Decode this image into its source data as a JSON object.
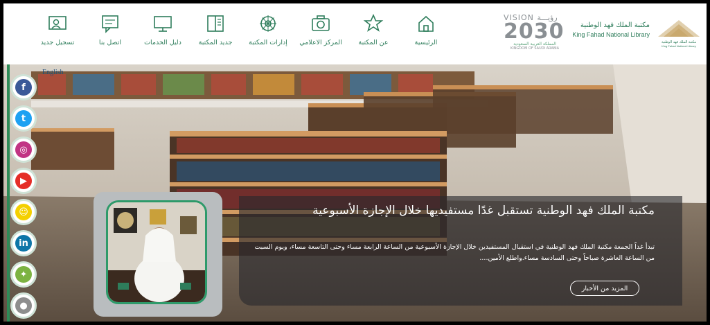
{
  "header": {
    "nav": [
      {
        "label": "الرئيسية",
        "icon": "home-icon"
      },
      {
        "label": "عن المكتبة",
        "icon": "star-icon"
      },
      {
        "label": "المركز الاعلامي",
        "icon": "camera-icon"
      },
      {
        "label": "إدارات المكتبة",
        "icon": "gear-icon"
      },
      {
        "label": "جديد المكتبة",
        "icon": "book-icon"
      },
      {
        "label": "دليل الخدمات",
        "icon": "monitor-icon"
      },
      {
        "label": "اتصل بنا",
        "icon": "message-icon"
      },
      {
        "label": "تسجيل جديد",
        "icon": "register-icon"
      }
    ],
    "vision": {
      "top": "VISION رؤيـــة",
      "year": "2030",
      "ar": "المملكة العربية السعودية",
      "en": "KINGDOM OF SAUDI ARABIA"
    },
    "brand": {
      "ar": "مكتبة الملك فهد الوطنية",
      "en": "King Fahad National Library"
    }
  },
  "hero": {
    "language_link": "English",
    "social": [
      {
        "name": "facebook",
        "glyph": "f",
        "color": "#3b5998"
      },
      {
        "name": "twitter",
        "glyph": "t",
        "color": "#1da1f2"
      },
      {
        "name": "instagram",
        "glyph": "◎",
        "color": "#c13584"
      },
      {
        "name": "youtube",
        "glyph": "▶",
        "color": "#e52d27"
      },
      {
        "name": "snapchat",
        "glyph": "☺",
        "color": "#f4d000"
      },
      {
        "name": "linkedin",
        "glyph": "in",
        "color": "#0e76a8"
      },
      {
        "name": "android",
        "glyph": "✦",
        "color": "#7cb342"
      },
      {
        "name": "apple",
        "glyph": "●",
        "color": "#8e8e8e"
      }
    ],
    "news": {
      "title": "مكتبة الملك فهد الوطنية تستقبل غدًا مستفيديها خلال الإجازة الأسبوعية",
      "body": "تبدأ غداً الجمعة مكتبة الملك فهد الوطنية في استقبال المستفيدين خلال الإجازة الأسبوعية من الساعة الرابعة مساء وحتى التاسعة مساء، ويوم السبت من الساعة العاشرة صباحاً وحتى السادسة مساء.واطلع الأمين....",
      "more_label": "المزيد من الأخبار"
    }
  }
}
